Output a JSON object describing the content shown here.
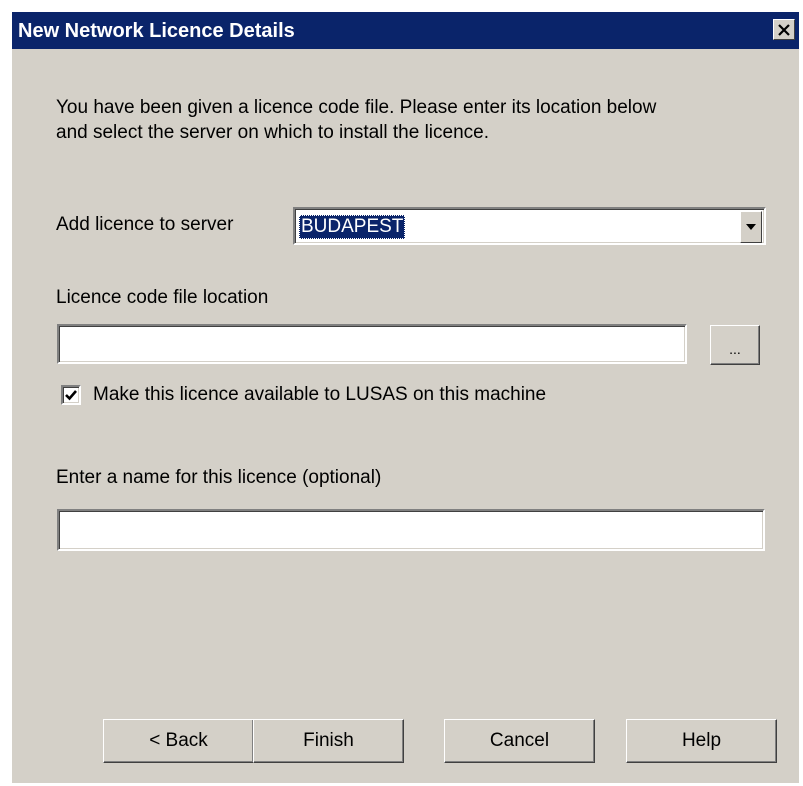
{
  "window": {
    "title": "New Network Licence Details",
    "close_icon": "close-icon"
  },
  "intro": {
    "line1": "You have been given a licence code file. Please enter its location below",
    "line2": "and select the server on which to install the licence."
  },
  "server": {
    "label": "Add licence to server",
    "selected": "BUDAPEST"
  },
  "file_location": {
    "label": "Licence code file location",
    "value": "",
    "browse_label": "..."
  },
  "availability": {
    "checked": true,
    "label": "Make this licence available to LUSAS on this machine"
  },
  "licence_name": {
    "label": "Enter a name for this licence (optional)",
    "value": ""
  },
  "buttons": {
    "back": "< Back",
    "finish": "Finish",
    "cancel": "Cancel",
    "help": "Help"
  },
  "colors": {
    "titlebar": "#0a246a",
    "dialog_face": "#d4d0c8",
    "selection": "#0a246a"
  }
}
